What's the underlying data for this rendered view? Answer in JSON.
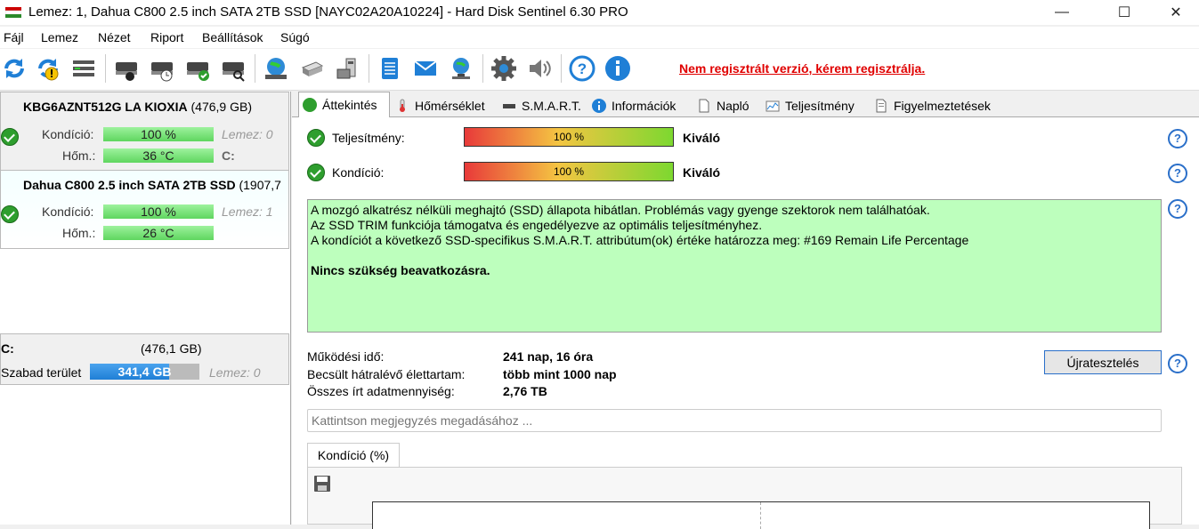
{
  "window": {
    "title": "Lemez: 1, Dahua C800 2.5 inch SATA 2TB SSD [NAYC02A20A10224]  -  Hard Disk Sentinel 6.30 PRO",
    "minimize": "—",
    "maximize": "☐",
    "close": "✕"
  },
  "menu": [
    "Fájl",
    "Lemez",
    "Nézet",
    "Riport",
    "Beállítások",
    "Súgó"
  ],
  "toolbar": {
    "registration_warning": "Nem regisztrált verzió, kérem regisztrálja.",
    "icons": [
      "refresh-icon",
      "refresh-warning-icon",
      "disk-list-icon",
      "disk-test-icon",
      "disk-schedule-icon",
      "disk-ok-icon",
      "disk-search-icon",
      "globe-disk-icon",
      "usb-disk-icon",
      "external-disk-icon",
      "report-icon",
      "email-icon",
      "network-icon",
      "settings-icon",
      "sound-icon",
      "help-icon",
      "info-icon"
    ]
  },
  "disks": [
    {
      "name": "KBG6AZNT512G LA KIOXIA",
      "size": "(476,9 GB)",
      "health_label": "Kondíció:",
      "health_value": "100 %",
      "temp_label": "Hőm.:",
      "temp_value": "36 °C",
      "disk_index": "Lemez: 0",
      "drive_letter": "C:"
    },
    {
      "name": "Dahua C800 2.5 inch SATA 2TB SSD",
      "size": "(1907,7",
      "health_label": "Kondíció:",
      "health_value": "100 %",
      "temp_label": "Hőm.:",
      "temp_value": "26 °C",
      "disk_index": "Lemez: 1"
    }
  ],
  "volume": {
    "letter": "C:",
    "size": "(476,1 GB)",
    "free_label": "Szabad terület",
    "free_value": "341,4 GB",
    "disk_index": "Lemez: 0",
    "free_fraction": 0.72
  },
  "tabs": [
    "Áttekintés",
    "Hőmérséklet",
    "S.M.A.R.T.",
    "Információk",
    "Napló",
    "Teljesítmény",
    "Figyelmeztetések"
  ],
  "overview": {
    "performance_label": "Teljesítmény:",
    "performance_value": "100 %",
    "performance_rating": "Kiváló",
    "health_label": "Kondíció:",
    "health_value": "100 %",
    "health_rating": "Kiváló",
    "status_lines": [
      "A mozgó alkatrész nélküli meghajtó (SSD) állapota hibátlan. Problémás vagy gyenge szektorok nem találhatóak.",
      "Az SSD TRIM funkciója támogatva és engedélyezve az optimális teljesítményhez.",
      "A kondíciót a következő SSD-specifikus S.M.A.R.T. attribútum(ok) értéke határozza meg:  #169 Remain Life Percentage"
    ],
    "status_bold": "Nincs szükség beavatkozásra.",
    "power_on_label": "Működési idő:",
    "power_on_value": "241 nap, 16 óra",
    "lifetime_label": "Becsült hátralévő élettartam:",
    "lifetime_value": "több mint 1000 nap",
    "written_label": "Összes írt adatmennyiség:",
    "written_value": "2,76 TB",
    "retest_button": "Újratesztelés",
    "note_placeholder": "Kattintson megjegyzés megadásához ...",
    "chart_tab": "Kondíció  (%)",
    "help_glyph": "?"
  },
  "colors": {
    "status_green": "#bdffbd",
    "warning_red": "#e00000",
    "help_blue": "#2a6fc9"
  }
}
